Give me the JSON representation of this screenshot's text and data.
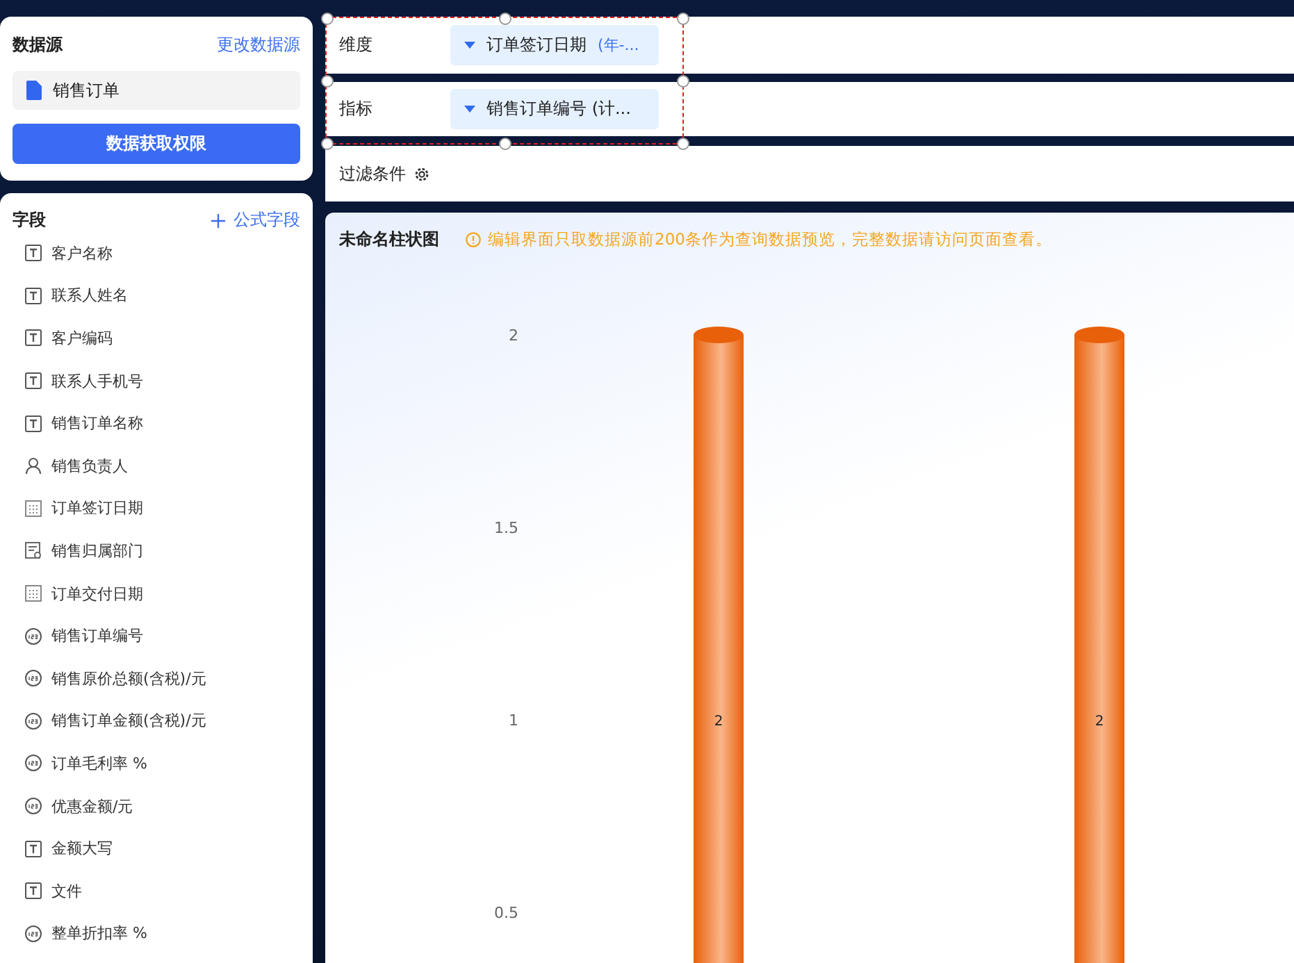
{
  "datasource": {
    "title": "数据源",
    "change_link": "更改数据源",
    "source": "销售订单",
    "permission_button": "数据获取权限"
  },
  "fields": {
    "title": "字段",
    "add_link": "公式字段",
    "items": [
      {
        "label": "客户名称",
        "kind": "text"
      },
      {
        "label": "联系人姓名",
        "kind": "text"
      },
      {
        "label": "客户编码",
        "kind": "text"
      },
      {
        "label": "联系人手机号",
        "kind": "text"
      },
      {
        "label": "销售订单名称",
        "kind": "text"
      },
      {
        "label": "销售负责人",
        "kind": "person"
      },
      {
        "label": "订单签订日期",
        "kind": "date"
      },
      {
        "label": "销售归属部门",
        "kind": "department"
      },
      {
        "label": "订单交付日期",
        "kind": "date"
      },
      {
        "label": "销售订单编号",
        "kind": "number"
      },
      {
        "label": "销售原价总额(含税)/元",
        "kind": "number"
      },
      {
        "label": "销售订单金额(含税)/元",
        "kind": "number"
      },
      {
        "label": "订单毛利率 %",
        "kind": "number"
      },
      {
        "label": "优惠金额/元",
        "kind": "number"
      },
      {
        "label": "金额大写",
        "kind": "text"
      },
      {
        "label": "文件",
        "kind": "text"
      },
      {
        "label": "整单折扣率 %",
        "kind": "number"
      }
    ]
  },
  "dimension": {
    "label": "维度",
    "value": "订单签订日期",
    "suffix": "(年-..."
  },
  "measure": {
    "label": "指标",
    "value": "销售订单编号 (计..."
  },
  "filter": {
    "label": "过滤条件"
  },
  "chart": {
    "title": "未命名柱状图",
    "notice": "编辑界面只取数据源前200条作为查询数据预览，完整数据请访问页面查看。",
    "y_axis_labels": [
      "2",
      "1.5",
      "1",
      "0.5"
    ],
    "bar_labels": [
      "2",
      "2"
    ]
  }
}
